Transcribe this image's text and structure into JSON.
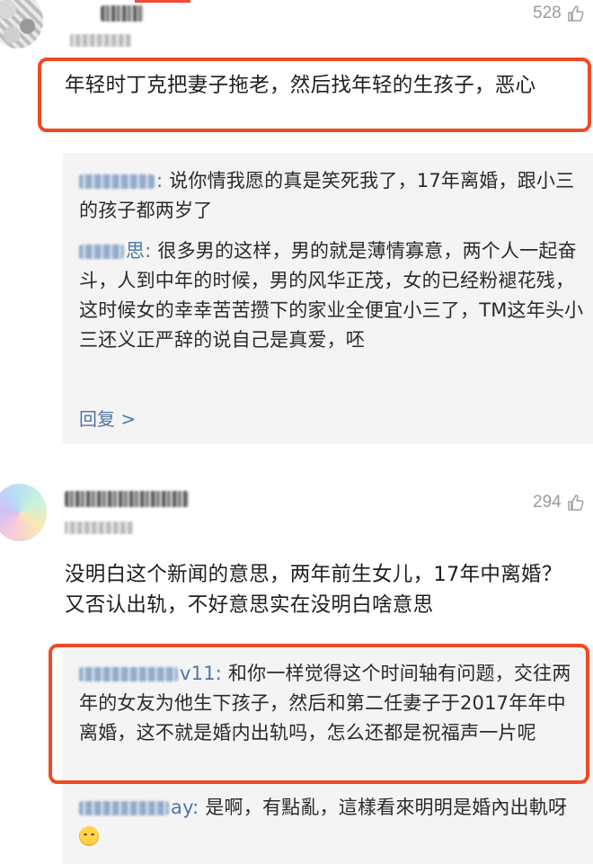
{
  "comments": [
    {
      "likes": "528",
      "text": "年轻时丁克把妻子拖老，然后找年轻的生孩子，恶心",
      "replies": [
        {
          "user_suffix": ":",
          "text": "说你情我愿的真是笑死我了，17年离婚，跟小三的孩子都两岁了"
        },
        {
          "user_suffix": "思:",
          "text": "很多男的这样，男的就是薄情寡意，两个人一起奋斗，人到中年的时候，男的风华正茂，女的已经粉褪花残，这时候女的幸幸苦苦攒下的家业全便宜小三了，TM这年头小三还义正严辞的说自己是真爱，呸"
        }
      ],
      "more_replies": "回复 >"
    },
    {
      "likes": "294",
      "text": "没明白这个新闻的意思，两年前生女儿，17年中离婚？又否认出轨，不好意思实在没明白啥意思",
      "replies": [
        {
          "user_suffix": "v11:",
          "text": "和你一样觉得这个时间轴有问题，交往两年的女友为他生下孩子，然后和第二任妻子于2017年年中离婚，这不就是婚内出轨吗，怎么还都是祝福声一片呢"
        },
        {
          "user_suffix": "ay:",
          "text": "是啊，有點亂，這樣看來明明是婚內出軌呀"
        }
      ]
    }
  ],
  "icons": {
    "like": "thumbs-up-icon",
    "emoji": "upside-down-face-emoji"
  },
  "colors": {
    "highlight": "#f04a23",
    "username": "#4c76a8",
    "panel_bg": "#f4f4f4",
    "meta": "#9b9b9b"
  }
}
